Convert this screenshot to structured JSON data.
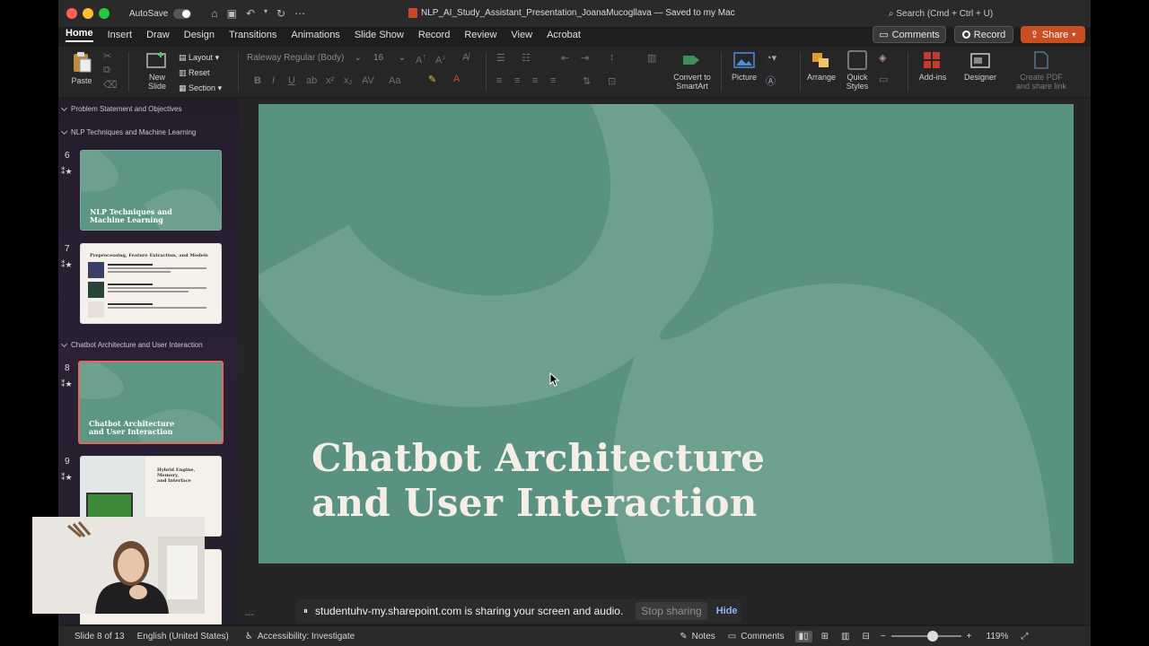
{
  "titlebar": {
    "autosave_label": "AutoSave",
    "doc_title": "NLP_AI_Study_Assistant_Presentation_JoanaMucogllava — Saved to my Mac",
    "search_label": "Search (Cmd + Ctrl + U)"
  },
  "tabs": [
    "Home",
    "Insert",
    "Draw",
    "Design",
    "Transitions",
    "Animations",
    "Slide Show",
    "Record",
    "Review",
    "View",
    "Acrobat"
  ],
  "header_buttons": {
    "comments": "Comments",
    "record": "Record",
    "share": "Share"
  },
  "ribbon": {
    "paste": "Paste",
    "new_slide_1": "New",
    "new_slide_2": "Slide",
    "layout": "Layout",
    "reset": "Reset",
    "section": "Section",
    "font_name": "Raleway Regular (Body)",
    "font_size": "16",
    "convert_1": "Convert to",
    "convert_2": "SmartArt",
    "picture": "Picture",
    "arrange": "Arrange",
    "quick_styles_1": "Quick",
    "quick_styles_2": "Styles",
    "addins": "Add-ins",
    "designer": "Designer",
    "create_pdf_1": "Create PDF",
    "create_pdf_2": "and share link"
  },
  "sidebar": {
    "sections": [
      "Problem Statement and Objectives",
      "NLP Techniques and Machine Learning",
      "Chatbot Architecture and User Interaction"
    ],
    "slides": [
      {
        "num": "6",
        "title_1": "NLP Techniques and",
        "title_2": "Machine Learning"
      },
      {
        "num": "7",
        "title": "Preprocessing, Feature Extraction, and Models"
      },
      {
        "num": "8",
        "title_1": "Chatbot Architecture",
        "title_2": "and User Interaction"
      },
      {
        "num": "9",
        "title_1": "Hybrid Engine, Memory,",
        "title_2": "and Interface"
      }
    ]
  },
  "slide": {
    "title_line1": "Chatbot Architecture",
    "title_line2": "and User Interaction",
    "bg_color": "#5a9281",
    "shape_color": "#6ea090"
  },
  "share_notice": {
    "text": "studentuhv-my.sharepoint.com is sharing your screen and audio.",
    "stop": "Stop sharing",
    "hide": "Hide"
  },
  "statusbar": {
    "slide_counter": "Slide 8 of 13",
    "language": "English (United States)",
    "accessibility": "Accessibility: Investigate",
    "notes": "Notes",
    "comments": "Comments",
    "zoom": "119%",
    "zoom_level": 0.6
  },
  "colors": {
    "accent": "#c94f22",
    "selected_border": "#e06a5e"
  }
}
